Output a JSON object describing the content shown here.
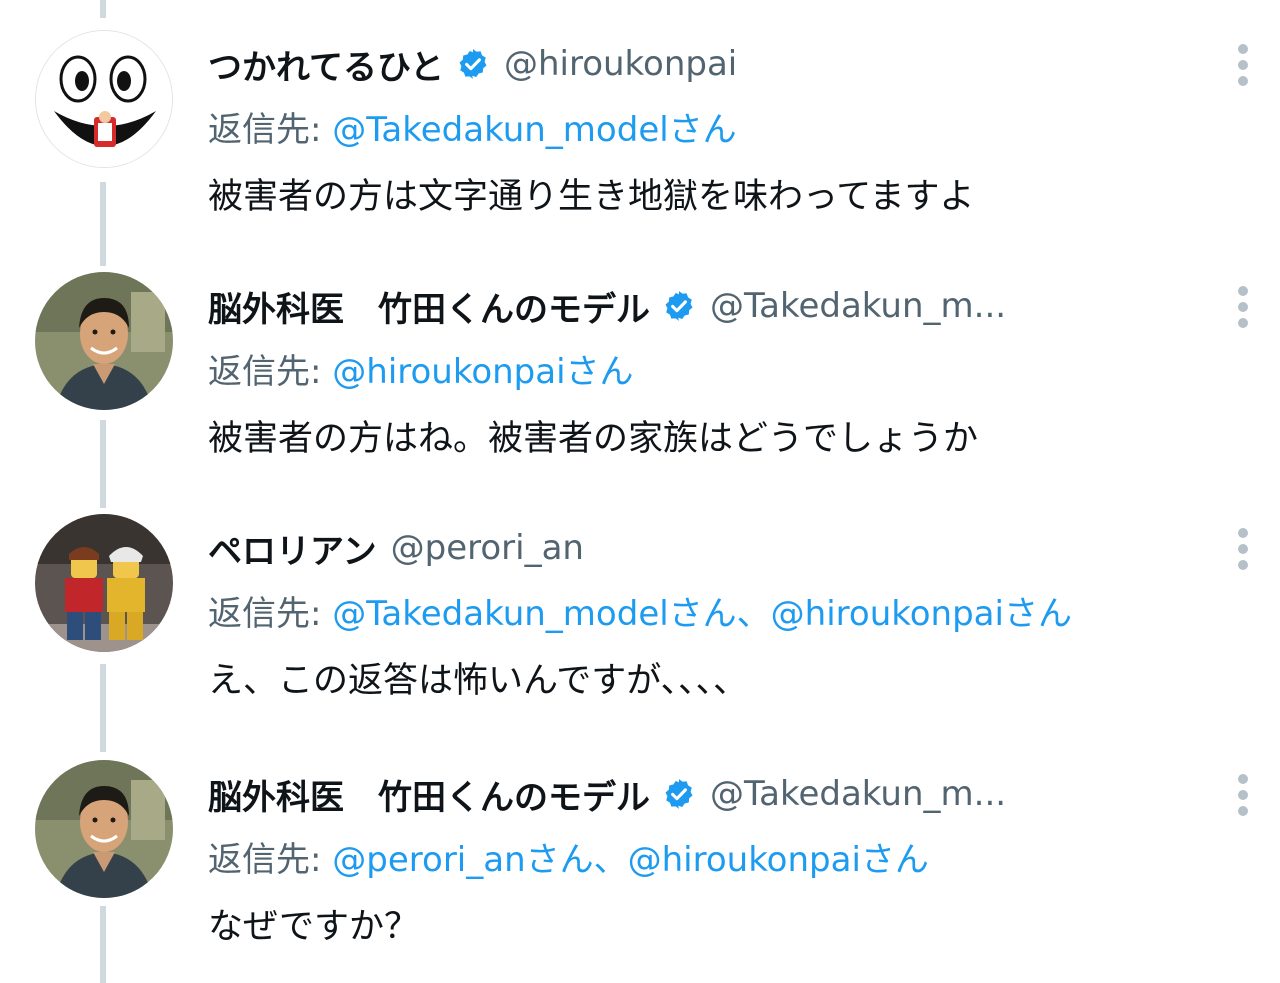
{
  "tweets": [
    {
      "display_name": "つかれてるひと",
      "handle": "@hiroukonpai",
      "verified": true,
      "reply_label": "返信先:",
      "reply_mentions": "@Takedakun_modelさん",
      "text": "被害者の方は文字通り生き地獄を味わってますよ",
      "avatar_icon": "cartoon-face-avatar-icon"
    },
    {
      "display_name": "脳外科医　竹田くんのモデル",
      "handle": "@Takedakun_m...",
      "verified": true,
      "reply_label": "返信先:",
      "reply_mentions": "@hiroukonpaiさん",
      "text": "被害者の方はね。被害者の家族はどうでしょうか",
      "avatar_icon": "illustrated-doctor-avatar-icon"
    },
    {
      "display_name": "ペロリアン",
      "handle": "@perori_an",
      "verified": false,
      "reply_label": "返信先:",
      "reply_mentions": "@Takedakun_modelさん、@hiroukonpaiさん",
      "text": "え、この返答は怖いんですが、、、、",
      "avatar_icon": "lego-figures-avatar-icon"
    },
    {
      "display_name": "脳外科医　竹田くんのモデル",
      "handle": "@Takedakun_m...",
      "verified": true,
      "reply_label": "返信先:",
      "reply_mentions": "@perori_anさん、@hiroukonpaiさん",
      "text": "なぜですか？",
      "avatar_icon": "illustrated-doctor-avatar-icon"
    }
  ],
  "colors": {
    "mention": "#1d9bf0",
    "secondary_text": "#536471",
    "primary_text": "#0f1419",
    "thread_line": "#cfd9de",
    "verified_badge": "#1d9bf0"
  },
  "icons": {
    "verified": "verified-badge-icon",
    "more": "more-options-icon"
  }
}
